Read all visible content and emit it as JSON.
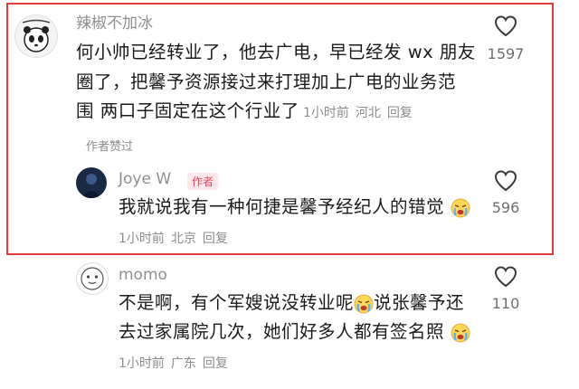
{
  "comments": [
    {
      "username": "辣椒不加冰",
      "lines": [
        "何小帅已经转业了，他去广电，早已经发 wx 朋友",
        "圈了，把馨予资源接过来打理加上广电的业务范",
        "围 两口子固定在这个行业了"
      ],
      "time": "1小时前",
      "location": "河北",
      "reply_label": "回复",
      "likes": "1597",
      "approved_label": "作者赞过"
    },
    {
      "username": "Joye W",
      "author_tag": "作者",
      "text": "我就说我有一种何捷是馨予经纪人的错觉",
      "time": "1小时前",
      "location": "北京",
      "reply_label": "回复",
      "likes": "596"
    },
    {
      "username": "momo",
      "line1_a": "不是啊，有个军嫂说没转业呢",
      "line1_b": "说张馨予还",
      "line2": "去过家属院几次，她们好多人都有签名照",
      "time": "1小时前",
      "location": "广东",
      "reply_label": "回复",
      "likes": "110"
    }
  ],
  "colors": {
    "highlight": "#e23a3a",
    "author_tag_bg": "#fde7ea",
    "author_tag_fg": "#e2465c"
  },
  "icons": {
    "like": "heart-outline-icon",
    "emoji": "crying-face-emoji"
  }
}
